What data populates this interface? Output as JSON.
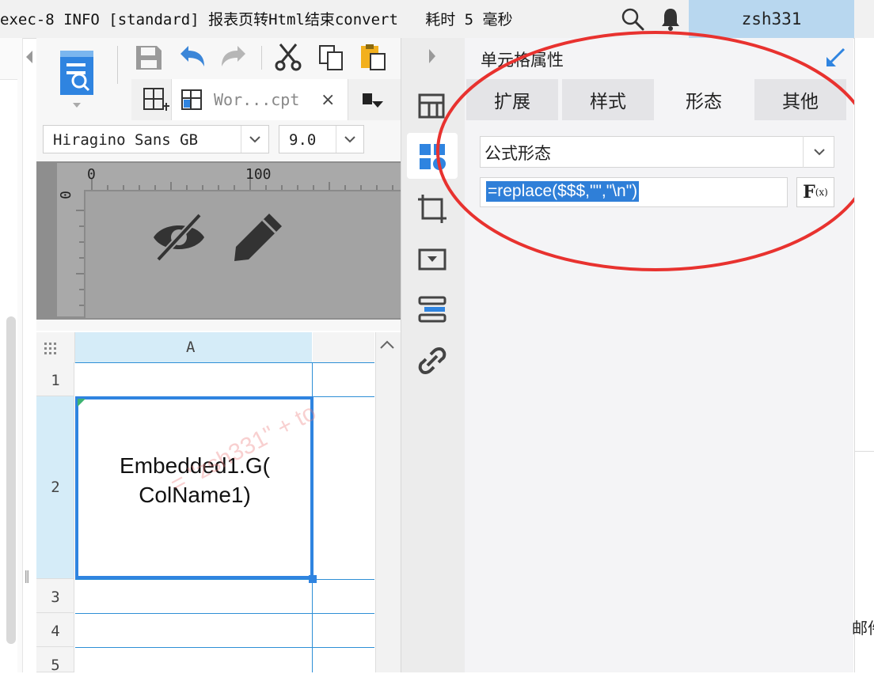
{
  "topbar": {
    "log_text": "exec-8 INFO [standard] 报表页转Html结束convert   耗时 5 毫秒",
    "user": "zsh331",
    "icons": [
      "search-icon",
      "bell-icon"
    ]
  },
  "designer": {
    "tab": {
      "label": "Wor...cpt",
      "close": "×"
    },
    "font": {
      "family": "Hiragino Sans GB",
      "size": "9.0"
    },
    "ruler": {
      "h_marks": [
        "0",
        "100"
      ],
      "v_mark": "0"
    },
    "preview_icons": [
      "eye-off-icon",
      "pencil-icon"
    ]
  },
  "grid": {
    "columns": [
      "A",
      ""
    ],
    "rows": [
      "1",
      "2",
      "3",
      "4",
      "5"
    ],
    "selected_cell_text_line1": "Embedded1.G(",
    "selected_cell_text_line2": "ColName1)",
    "watermark": "= \"zsh331\" + to"
  },
  "panel": {
    "title": "单元格属性",
    "tabs": [
      "扩展",
      "样式",
      "形态",
      "其他"
    ],
    "active_tab": "形态",
    "shape_select": "公式形态",
    "formula": "=replace($$$,\"\",\"\\n\")",
    "fx_label": "F",
    "fx_sub": "(x)"
  },
  "right_gutter_text": "邮件",
  "colors": {
    "accent": "#2f84e0",
    "annotation": "#e8322f",
    "user_box": "#b8d7ef"
  }
}
